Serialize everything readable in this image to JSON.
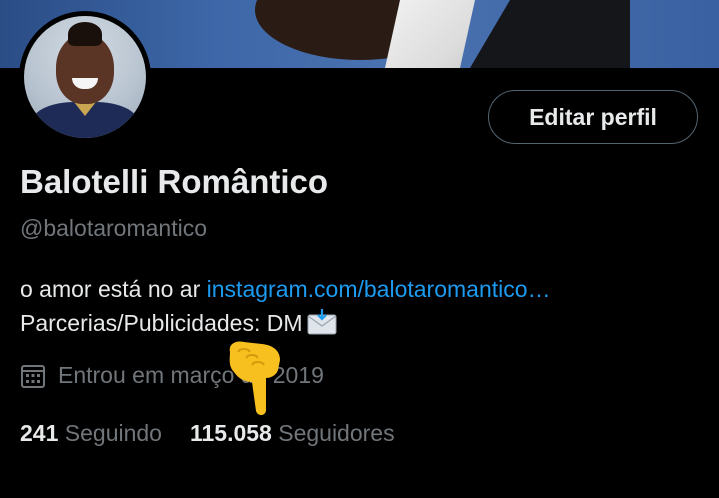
{
  "profile": {
    "display_name": "Balotelli Romântico",
    "handle": "@balotaromantico",
    "bio_text": "o amor está no ar ",
    "bio_link": "instagram.com/balotaromantico…",
    "bio_line2": "Parcerias/Publicidades: DM",
    "joined": "Entrou em março de 2019",
    "following_count": "241",
    "following_label": "Seguindo",
    "followers_count": "115.058",
    "followers_label": "Seguidores"
  },
  "actions": {
    "edit_label": "Editar perfil"
  },
  "icons": {
    "calendar": "calendar-icon",
    "mail": "incoming-envelope-icon",
    "pointer": "pointing-down-hand-icon"
  },
  "colors": {
    "background": "#000000",
    "text": "#e7e9ea",
    "muted": "#71767b",
    "link": "#1d9bf0",
    "button_border": "#536471"
  }
}
